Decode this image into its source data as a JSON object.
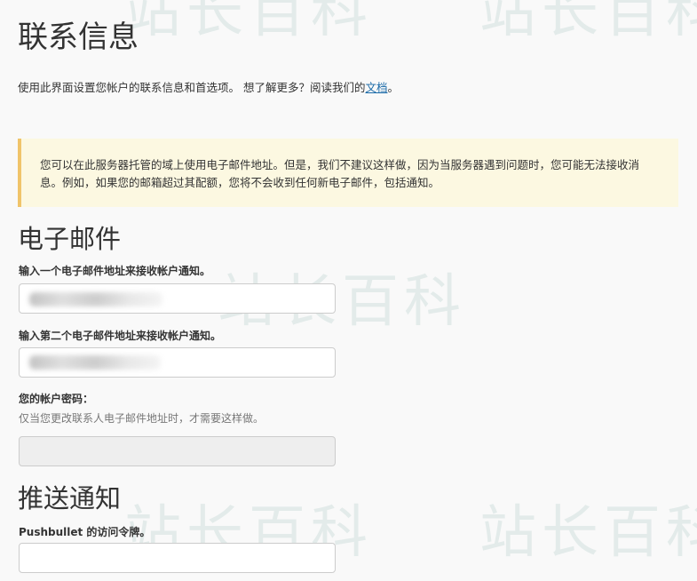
{
  "page_title": "联系信息",
  "intro": {
    "text": "使用此界面设置您帐户的联系信息和首选项。 想了解更多？阅读我们的",
    "link_label": "文档",
    "suffix": "。"
  },
  "notice": {
    "text": "您可以在此服务器托管的域上使用电子邮件地址。但是，我们不建议这样做，因为当服务器遇到问题时，您可能无法接收消息。例如，如果您的邮箱超过其配额，您将不会收到任何新电子邮件，包括通知。"
  },
  "email_section": {
    "title": "电子邮件",
    "primary_label": "输入一个电子邮件地址来接收帐户通知。",
    "secondary_label": "输入第二个电子邮件地址来接收帐户通知。",
    "password_label": "您的帐户密码：",
    "password_help": "仅当您更改联系人电子邮件地址时，才需要这样做。"
  },
  "push_section": {
    "title": "推送通知",
    "pushbullet_label": "Pushbullet 的访问令牌。"
  },
  "watermark": "站长百科"
}
